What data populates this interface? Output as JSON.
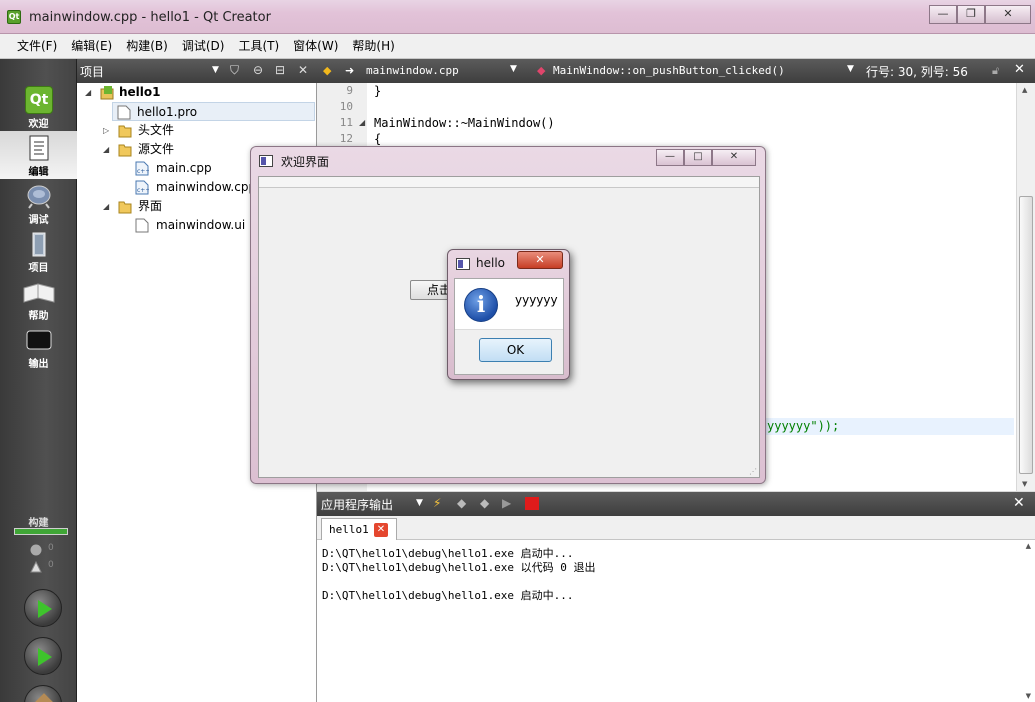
{
  "window": {
    "title": "mainwindow.cpp - hello1 - Qt Creator",
    "app_icon": "Qt",
    "minimize": "—",
    "maximize": "❐",
    "close": "✕"
  },
  "menubar": {
    "items": [
      "文件(F)",
      "编辑(E)",
      "构建(B)",
      "调试(D)",
      "工具(T)",
      "窗体(W)",
      "帮助(H)"
    ]
  },
  "modebar": {
    "modes": [
      {
        "label": "欢迎",
        "icon": "qt-logo-icon"
      },
      {
        "label": "编辑",
        "icon": "document-edit-icon"
      },
      {
        "label": "调试",
        "icon": "debug-bug-icon"
      },
      {
        "label": "项目",
        "icon": "project-icon"
      },
      {
        "label": "帮助",
        "icon": "help-book-icon"
      },
      {
        "label": "输出",
        "icon": "output-monitor-icon"
      }
    ],
    "build_label": "构建",
    "error_count": "0",
    "warning_count": "0"
  },
  "project_panel": {
    "title": "项目",
    "tree": [
      {
        "label": "hello1",
        "bold": true
      },
      {
        "label": "hello1.pro"
      },
      {
        "label": "头文件"
      },
      {
        "label": "源文件"
      },
      {
        "label": "main.cpp"
      },
      {
        "label": "mainwindow.cpp"
      },
      {
        "label": "界面"
      },
      {
        "label": "mainwindow.ui"
      }
    ]
  },
  "editor_toolbar": {
    "file": "mainwindow.cpp",
    "symbol": "MainWindow::on_pushButton_clicked()",
    "position": "行号: 30, 列号: 56"
  },
  "editor": {
    "lines": [
      {
        "num": "9",
        "code": "}"
      },
      {
        "num": "10",
        "code": ""
      },
      {
        "num": "11",
        "code": "MainWindow::~MainWindow()"
      },
      {
        "num": "12",
        "code": "{"
      }
    ],
    "partial_line": "yyyyyy\"));"
  },
  "output": {
    "title": "应用程序输出",
    "tab": "hello1",
    "tab_close": "✕",
    "lines": [
      "D:\\QT\\hello1\\debug\\hello1.exe 启动中...",
      "D:\\QT\\hello1\\debug\\hello1.exe 以代码 0 退出",
      "",
      "D:\\QT\\hello1\\debug\\hello1.exe 启动中..."
    ]
  },
  "welcome_window": {
    "title": "欢迎界面",
    "button_label": "点击",
    "minimize": "—",
    "maximize": "□",
    "close": "✕"
  },
  "message_box": {
    "title": "hello",
    "text": "yyyyyy",
    "ok": "OK",
    "close": "✕",
    "icon": "i"
  }
}
